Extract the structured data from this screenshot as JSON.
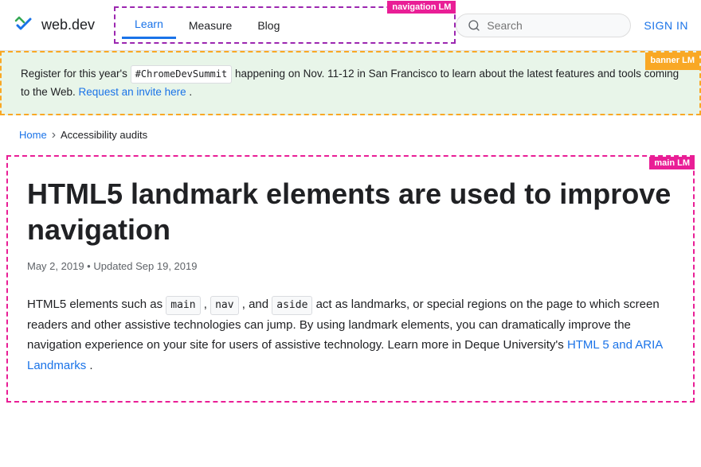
{
  "header": {
    "logo_text": "web.dev",
    "nav_items": [
      {
        "label": "Learn",
        "active": true
      },
      {
        "label": "Measure",
        "active": false
      },
      {
        "label": "Blog",
        "active": false
      }
    ],
    "nav_label": "navigation LM",
    "search_placeholder": "Search",
    "sign_in_label": "SIGN IN"
  },
  "banner": {
    "label": "banner LM",
    "text_before": "Register for this year's",
    "hashtag": "#ChromeDevSummit",
    "text_middle": "happening on Nov. 11-12 in San Francisco to learn about the latest features and tools coming to the Web.",
    "link_text": "Request an invite here",
    "text_after": "."
  },
  "breadcrumb": {
    "home_label": "Home",
    "separator": "›",
    "current": "Accessibility audits"
  },
  "main": {
    "label": "main LM",
    "article_title": "HTML5 landmark elements are used to improve navigation",
    "article_date": "May 2, 2019",
    "article_separator": "•",
    "article_updated": "Updated Sep 19, 2019",
    "body_text_1": "HTML5 elements such as",
    "code1": "main",
    "comma1": ",",
    "code2": "nav",
    "comma2": ", and",
    "code3": "aside",
    "body_text_2": "act as landmarks, or special regions on the page to which screen readers and other assistive technologies can jump. By using landmark elements, you can dramatically improve the navigation experience on your site for users of assistive technology. Learn more in Deque University's",
    "body_link_text": "HTML 5 and ARIA Landmarks",
    "body_text_end": "."
  }
}
